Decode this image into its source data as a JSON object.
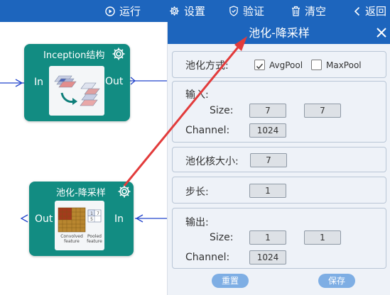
{
  "toolbar": {
    "run": "运行",
    "settings": "设置",
    "validate": "验证",
    "clear": "清空",
    "back": "返回"
  },
  "canvas": {
    "inception_node": {
      "title": "Inception结构",
      "in": "In",
      "out": "Out"
    },
    "pool_node": {
      "title": "池化-降采样",
      "in": "In",
      "out": "Out",
      "thumb_left": "Convolved feature",
      "thumb_right": "Pooled feature",
      "grid": [
        "1",
        "7",
        "5",
        ""
      ]
    }
  },
  "panel": {
    "title": "池化-降采样",
    "pool_method_label": "池化方式:",
    "avgpool": {
      "label": "AvgPool",
      "checked": true
    },
    "maxpool": {
      "label": "MaxPool",
      "checked": false
    },
    "input": {
      "title": "输入:",
      "size_label": "Size:",
      "size_w": "7",
      "size_h": "7",
      "channel_label": "Channel:",
      "channel": "1024"
    },
    "kernel": {
      "label": "池化核大小:",
      "value": "7"
    },
    "stride": {
      "label": "步长:",
      "value": "1"
    },
    "output": {
      "title": "输出:",
      "size_label": "Size:",
      "size_w": "1",
      "size_h": "1",
      "channel_label": "Channel:",
      "channel": "1024"
    },
    "reset_button": "重置",
    "save_button": "保存"
  },
  "colors": {
    "toolbar": "#1d65bd",
    "node": "#128c82",
    "panel_bg": "#eef2f8",
    "arrow": "#e23b3b",
    "edge": "#2244cc",
    "button": "#7eaee4"
  }
}
